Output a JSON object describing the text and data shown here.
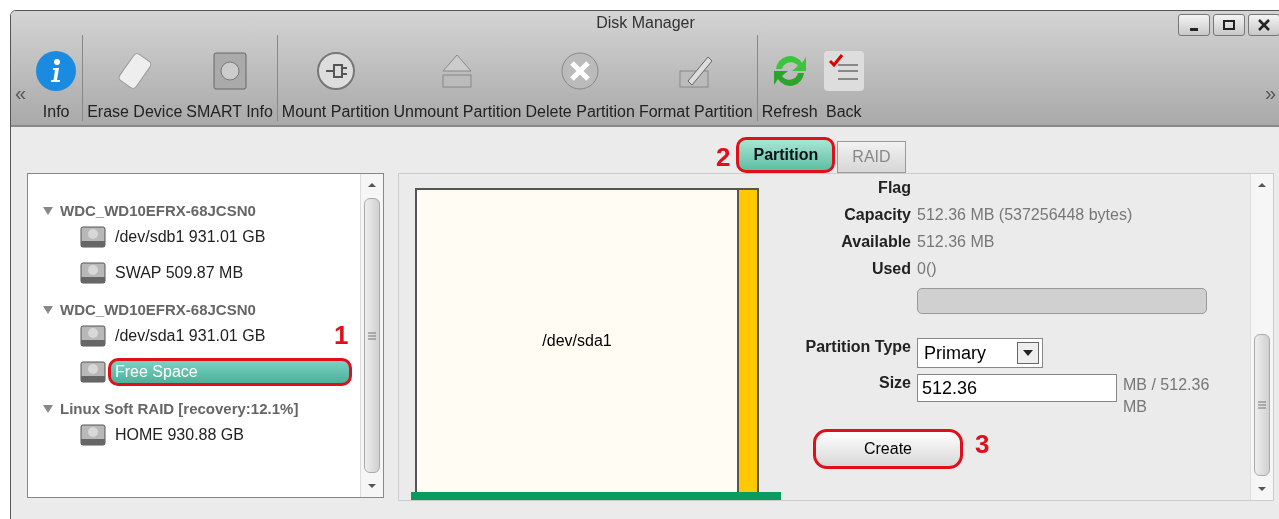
{
  "window": {
    "title": "Disk Manager"
  },
  "toolbar": {
    "scroll_left": "«",
    "scroll_right": "»",
    "groups": [
      [
        {
          "label": "Info"
        }
      ],
      [
        {
          "label": "Erase Device"
        },
        {
          "label": "SMART Info"
        }
      ],
      [
        {
          "label": "Mount Partition"
        },
        {
          "label": "Unmount Partition"
        },
        {
          "label": "Delete Partition"
        },
        {
          "label": "Format Partition"
        }
      ],
      [
        {
          "label": "Refresh"
        },
        {
          "label": "Back"
        }
      ]
    ]
  },
  "tree": [
    {
      "label": "WDC_WD10EFRX-68JCSN0",
      "expanded": true,
      "children": [
        {
          "label": "/dev/sdb1 931.01 GB",
          "selected": false,
          "highlighted": false
        },
        {
          "label": "SWAP 509.87 MB",
          "selected": false,
          "highlighted": false
        }
      ]
    },
    {
      "label": "WDC_WD10EFRX-68JCSN0",
      "expanded": true,
      "children": [
        {
          "label": "/dev/sda1 931.01 GB",
          "selected": false,
          "highlighted": false
        },
        {
          "label": "Free Space",
          "selected": true,
          "highlighted": true,
          "callout": "1"
        }
      ]
    },
    {
      "label": "Linux Soft RAID [recovery:12.1%]",
      "expanded": true,
      "children": [
        {
          "label": "HOME 930.88 GB",
          "selected": false,
          "highlighted": false
        }
      ]
    }
  ],
  "tabs": [
    {
      "label": "Partition",
      "selected": true,
      "highlighted": true,
      "callout": "2"
    },
    {
      "label": "RAID",
      "selected": false,
      "highlighted": false
    }
  ],
  "partition_map": {
    "label": "/dev/sda1"
  },
  "details": [
    {
      "label": "Flag"
    },
    {
      "label": "Capacity",
      "value": "512.36 MB (537256448 bytes)"
    },
    {
      "label": "Available",
      "value": "512.36 MB"
    },
    {
      "label": "Used",
      "value": "0()"
    }
  ],
  "form": {
    "partition_type": {
      "label": "Partition Type",
      "value": "Primary"
    },
    "size": {
      "label": "Size",
      "value": "512.36",
      "unit": "MB / 512.36 MB"
    }
  },
  "create_button": {
    "label": "Create",
    "highlighted": true,
    "callout": "3"
  }
}
